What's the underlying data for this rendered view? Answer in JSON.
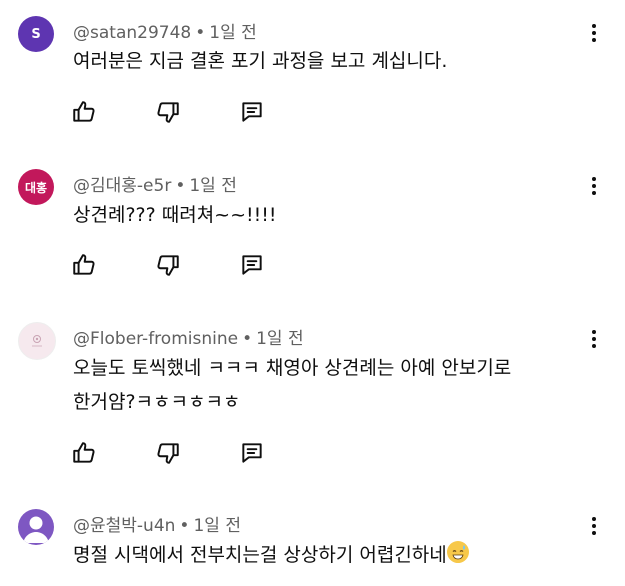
{
  "comments": [
    {
      "author": "@satan29748",
      "time": "1일 전",
      "avatar_letter": "S",
      "avatar_color": "#5e35b1",
      "text": "여러분은 지금 결혼 포기 과정을 보고 계십니다."
    },
    {
      "author": "@김대홍-e5r",
      "time": "1일 전",
      "avatar_letter": "대홍",
      "avatar_color": "#c2185b",
      "text": "상견례??? 때려쳐~~!!!!"
    },
    {
      "author": "@Flober-fromisnine",
      "time": "1일 전",
      "avatar_color": "#f6e9ee",
      "text_line1": "오늘도 토씩했네 ㅋㅋㅋ 채영아 상견례는 아예 안보기로",
      "text_line2": "한거얌?ㅋㅎㅋㅎㅋㅎ"
    },
    {
      "author": "@윤철박-u4n",
      "time": "1일 전",
      "avatar_color": "#7e57c2",
      "text": "명절 시댁에서 전부치는걸 상상하기 어렵긴하네",
      "emoji": "grinning-sweat-emoji"
    }
  ],
  "icons": {
    "like": "thumb-up-icon",
    "dislike": "thumb-down-icon",
    "reply": "reply-comment-icon",
    "more": "more-vertical-icon"
  }
}
